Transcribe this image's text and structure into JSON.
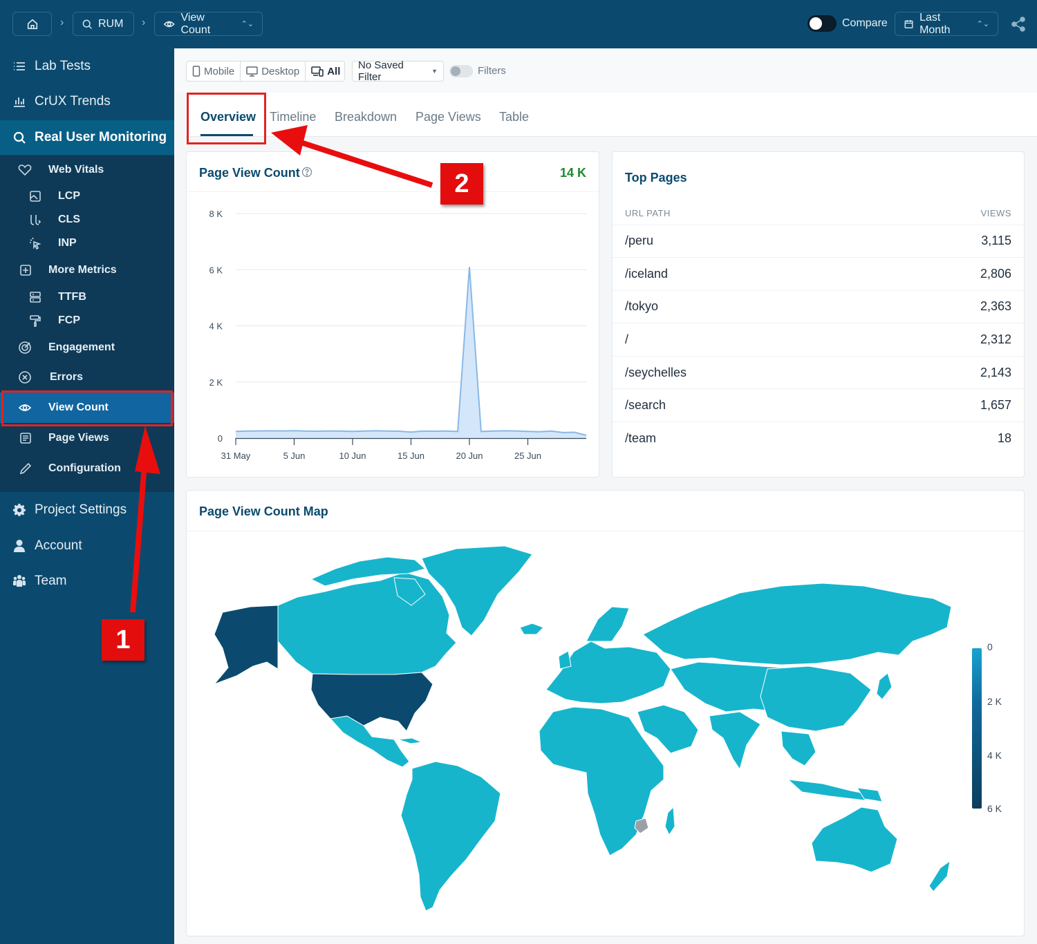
{
  "topbar": {
    "home_icon": "home-icon",
    "crumb_rum": "RUM",
    "crumb_view_count": "View Count",
    "separator": "›",
    "compare_label": "Compare",
    "date_range": "Last Month"
  },
  "sidebar": {
    "lab_tests": "Lab Tests",
    "crux_trends": "CrUX Trends",
    "rum": "Real User Monitoring",
    "web_vitals": "Web Vitals",
    "lcp": "LCP",
    "cls": "CLS",
    "inp": "INP",
    "more_metrics": "More Metrics",
    "ttfb": "TTFB",
    "fcp": "FCP",
    "engagement": "Engagement",
    "errors": "Errors",
    "view_count": "View Count",
    "page_views": "Page Views",
    "configuration": "Configuration",
    "project_settings": "Project Settings",
    "account": "Account",
    "team": "Team"
  },
  "filters": {
    "mobile": "Mobile",
    "desktop": "Desktop",
    "all": "All",
    "saved_filter": "No Saved Filter",
    "filters_label": "Filters"
  },
  "tabs": [
    "Overview",
    "Timeline",
    "Breakdown",
    "Page Views",
    "Table"
  ],
  "page_view_card": {
    "title": "Page View Count",
    "total": "14 K"
  },
  "chart_data": {
    "type": "area",
    "title": "Page View Count",
    "x_tick_labels": [
      "31 May",
      "5 Jun",
      "10 Jun",
      "15 Jun",
      "20 Jun",
      "25 Jun"
    ],
    "y_tick_labels": [
      "0",
      "2 K",
      "4 K",
      "6 K",
      "8 K"
    ],
    "ylim": [
      0,
      8000
    ],
    "grid": true,
    "x": [
      "31 May",
      "1 Jun",
      "2 Jun",
      "3 Jun",
      "4 Jun",
      "5 Jun",
      "6 Jun",
      "7 Jun",
      "8 Jun",
      "9 Jun",
      "10 Jun",
      "11 Jun",
      "12 Jun",
      "13 Jun",
      "14 Jun",
      "15 Jun",
      "16 Jun",
      "17 Jun",
      "18 Jun",
      "19 Jun",
      "20 Jun",
      "21 Jun",
      "22 Jun",
      "23 Jun",
      "24 Jun",
      "25 Jun",
      "26 Jun",
      "27 Jun",
      "28 Jun",
      "29 Jun",
      "30 Jun"
    ],
    "values": [
      240,
      250,
      255,
      260,
      255,
      265,
      250,
      245,
      255,
      250,
      240,
      250,
      260,
      250,
      245,
      215,
      250,
      245,
      250,
      240,
      6100,
      240,
      250,
      260,
      255,
      240,
      230,
      250,
      200,
      210,
      100
    ],
    "color": "#8ab8e6"
  },
  "top_pages": {
    "title": "Top Pages",
    "col_path": "URL PATH",
    "col_views": "VIEWS",
    "rows": [
      {
        "path": "/peru",
        "views": "3,115"
      },
      {
        "path": "/iceland",
        "views": "2,806"
      },
      {
        "path": "/tokyo",
        "views": "2,363"
      },
      {
        "path": "/",
        "views": "2,312"
      },
      {
        "path": "/seychelles",
        "views": "2,143"
      },
      {
        "path": "/search",
        "views": "1,657"
      },
      {
        "path": "/team",
        "views": "18"
      }
    ]
  },
  "map_card": {
    "title": "Page View Count Map",
    "legend_labels": [
      "0",
      "2 K",
      "4 K",
      "6 K"
    ],
    "color_low": "#17b5cc",
    "color_high": "#0b4a6e"
  },
  "annotations": {
    "badge_1": "1",
    "badge_2": "2"
  },
  "colors": {
    "brand": "#0b4a6e",
    "accent_red": "#e32222",
    "total_green": "#1a8a2e"
  }
}
